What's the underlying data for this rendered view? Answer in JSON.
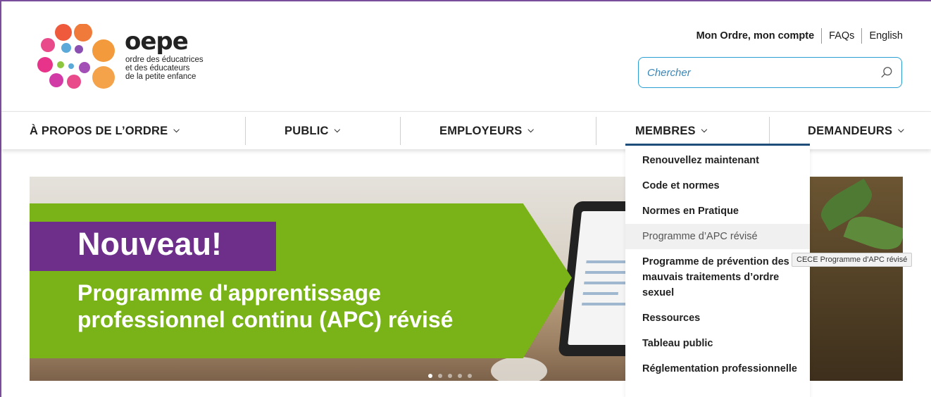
{
  "brand": {
    "logo_word": "oepe",
    "tagline_lines": [
      "ordre des éducatrices",
      "et des éducateurs",
      "de la petite enfance"
    ],
    "circle_colors": [
      "#f05a3c",
      "#f28a3c",
      "#e94a7a",
      "#d23aa5",
      "#5aa9d8",
      "#8a4fb0",
      "#f5a34a",
      "#8cc63f"
    ]
  },
  "utility_nav": {
    "account": "Mon Ordre, mon compte",
    "faqs": "FAQs",
    "language": "English"
  },
  "search": {
    "placeholder": "Chercher",
    "icon": "search-icon"
  },
  "main_nav": [
    {
      "label": "À PROPOS DE L’ORDRE",
      "chevron": "chevron-down-icon"
    },
    {
      "label": "PUBLIC",
      "chevron": "chevron-down-icon"
    },
    {
      "label": "EMPLOYEURS",
      "chevron": "chevron-down-icon"
    },
    {
      "label": "MEMBRES",
      "chevron": "chevron-down-icon",
      "active": true
    },
    {
      "label": "DEMANDEURS",
      "chevron": "chevron-down-icon"
    }
  ],
  "members_menu": {
    "items": [
      "Renouvellez maintenant",
      "Code et normes",
      "Normes en Pratique",
      "Programme d’APC révisé",
      "Programme de prévention des mauvais traitements d’ordre sexuel",
      "Ressources",
      "Tableau public",
      "Réglementation professionnelle"
    ],
    "hovered_index": 3,
    "tooltip": "CECE Programme d'APC révisé"
  },
  "hero": {
    "title": "Nouveau!",
    "subtitle_line1": "Programme d'apprentissage",
    "subtitle_line2": "professionnel continu (APC) révisé",
    "colors": {
      "green": "#7ab317",
      "purple": "#6d2f8a"
    },
    "slide_count": 5,
    "active_slide": 1
  },
  "colors": {
    "accent_blue": "#2b9fd1",
    "nav_active": "#1e4e79",
    "frame": "#7a4d9c"
  }
}
